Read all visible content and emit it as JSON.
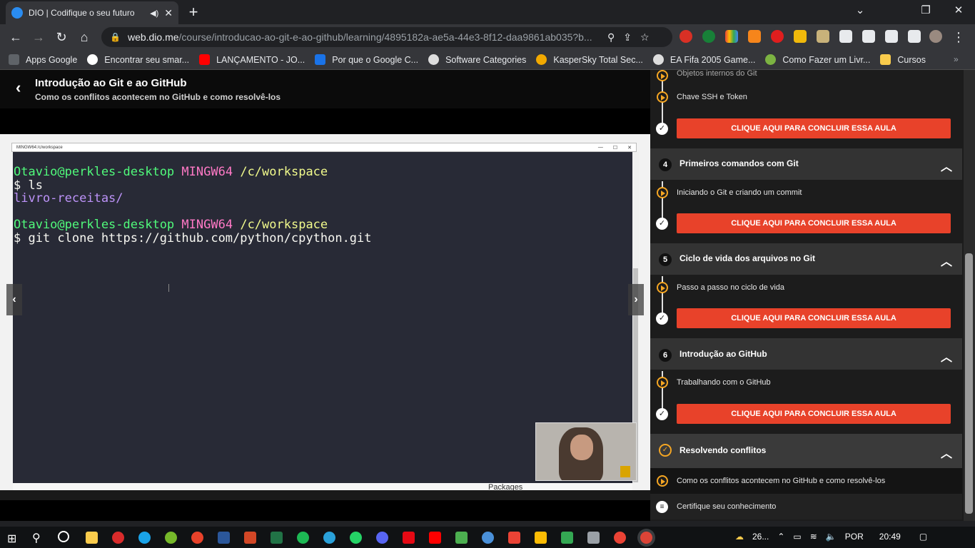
{
  "browser": {
    "tab_title": "DIO | Codifique o seu futuro",
    "tab_audio": "◀)",
    "tab_close": "✕",
    "new_tab": "+",
    "minimize": "⌄",
    "restore": "❐",
    "close": "✕",
    "url_host": "web.dio.me",
    "url_path": "/course/introducao-ao-git-e-ao-github/learning/4895182a-ae5a-44e3-8f12-daa9861ab035?b..."
  },
  "bookmarks": [
    {
      "label": "Apps Google",
      "color": "#5f6368"
    },
    {
      "label": "Encontrar seu smar...",
      "color": "#ffffff"
    },
    {
      "label": "LANÇAMENTO - JO...",
      "color": "#ff0000"
    },
    {
      "label": "Por que o Google C...",
      "color": "#1a73e8"
    },
    {
      "label": "Software Categories",
      "color": "#dddddd"
    },
    {
      "label": "KasperSky Total Sec...",
      "color": "#f2a900"
    },
    {
      "label": "EA Fifa 2005 Game...",
      "color": "#dddddd"
    },
    {
      "label": "Como Fazer um Livr...",
      "color": "#7cb342"
    },
    {
      "label": "Cursos",
      "color": "#f9cb4c"
    }
  ],
  "lesson": {
    "back": "‹",
    "title": "Introdução ao Git e ao GitHub",
    "subtitle": "Como os conflitos acontecem no GitHub e como resolvê-los"
  },
  "terminal": {
    "window_title": "MINGW64:/c/workspace",
    "user": "Otavio@perkles-desktop",
    "shell": "MINGW64",
    "path": "/c/workspace",
    "cmd1": "$ ls",
    "out1": "livro-receitas/",
    "cmd2": "$ git clone https://github.com/python/cpython.git"
  },
  "video": {
    "below_text": "Packages",
    "prev": "‹",
    "next": "›"
  },
  "sidebar": {
    "top_partial": "Objetos internos do Git",
    "lesson_ssh": "Chave SSH e Token",
    "done_label": "CLIQUE AQUI PARA CONCLUIR ESSA AULA",
    "modules": [
      {
        "num": "4",
        "title": "Primeiros comandos com Git",
        "lesson": "Iniciando o Git e criando um commit"
      },
      {
        "num": "5",
        "title": "Ciclo de vida dos arquivos no Git",
        "lesson": "Passo a passo no ciclo de vida"
      },
      {
        "num": "6",
        "title": "Introdução ao GitHub",
        "lesson": "Trabalhando com o GitHub"
      }
    ],
    "current_module": "Resolvendo conflitos",
    "current_lesson": "Como os conflitos acontecem no GitHub e como resolvê-los",
    "quiz": "Certifique seu conhecimento"
  },
  "taskbar": {
    "temp": "26...",
    "lang": "POR",
    "time": "20:49"
  }
}
